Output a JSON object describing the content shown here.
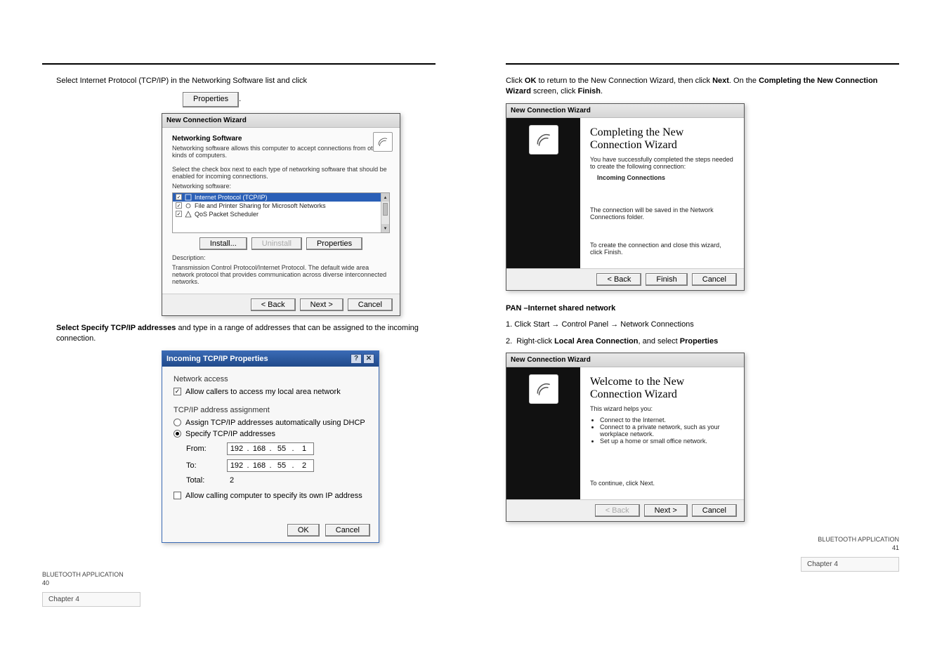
{
  "left": {
    "chapter_bar": "Chapter 4",
    "instr1_pre": "Select Internet Protocol (TCP/IP) in the Networking Software list and click",
    "properties_btn": "Properties",
    "wiz1": {
      "title": "New Connection Wizard",
      "head": "Networking Software",
      "sub": "Networking software allows this computer to accept connections from other kinds of computers.",
      "prompt": "Select the check box next to each type of networking software that should be enabled for incoming connections.",
      "list_label": "Networking software:",
      "items": {
        "tcpip": "Internet Protocol (TCP/IP)",
        "fp": "File and Printer Sharing for Microsoft Networks",
        "qos": "QoS Packet Scheduler"
      },
      "install": "Install...",
      "uninstall": "Uninstall",
      "props": "Properties",
      "desc_lbl": "Description:",
      "desc": "Transmission Control Protocol/Internet Protocol. The default wide area network protocol that provides communication across diverse interconnected networks.",
      "back": "< Back",
      "next": "Next >",
      "cancel": "Cancel"
    },
    "instr2": "Select Specify TCP/IP addresses and type in a range of addresses that can be assigned to the incoming connection.",
    "dlg": {
      "title": "Incoming TCP/IP Properties",
      "grp_net": "Network access",
      "allow_callers": "Allow callers to access my local area network",
      "grp_addr": "TCP/IP address assignment",
      "opt_dhcp": "Assign TCP/IP addresses automatically using DHCP",
      "opt_spec": "Specify TCP/IP addresses",
      "from_lbl": "From:",
      "to_lbl": "To:",
      "total_lbl": "Total:",
      "from": [
        "192",
        "168",
        "55",
        "1"
      ],
      "to": [
        "192",
        "168",
        "55",
        "2"
      ],
      "total": "2",
      "allow_own": "Allow calling computer to specify its own IP address",
      "ok": "OK",
      "cancel": "Cancel"
    },
    "bt_ref": "BLUETOOTH APPLICATION",
    "page_no": "40"
  },
  "right": {
    "chapter_bar": "Chapter 4",
    "instr1": "Click OK to return to the New Connection Wizard, then click Next. On the Completing the New Connection Wizard screen, click Finish.",
    "wiz_finish": {
      "title": "New Connection Wizard",
      "heading": "Completing the New Connection Wizard",
      "line1": "You have successfully completed the steps needed to create the following connection:",
      "conn_name": "Incoming Connections",
      "line2": "The connection will be saved in the Network Connections folder.",
      "line3": "To create the connection and close this wizard, click Finish.",
      "back": "< Back",
      "finish": "Finish",
      "cancel": "Cancel"
    },
    "pan_head": "PAN –Internet shared network",
    "pan_step1_a": "1.  Click Start ",
    "pan_step1_b": " Control Panel ",
    "pan_step1_c": " Network Connections",
    "pan_step2": "2.  Right-click Local Area Connection, and select Properties",
    "wiz_welcome": {
      "title": "New Connection Wizard",
      "heading": "Welcome to the New Connection Wizard",
      "line1": "This wizard helps you:",
      "b1": "Connect to the Internet.",
      "b2": "Connect to a private network, such as your workplace network.",
      "b3": "Set up a home or small office network.",
      "line2": "To continue, click Next.",
      "back": "< Back",
      "next": "Next >",
      "cancel": "Cancel"
    },
    "bt_ref": "BLUETOOTH APPLICATION",
    "page_no": "41"
  }
}
